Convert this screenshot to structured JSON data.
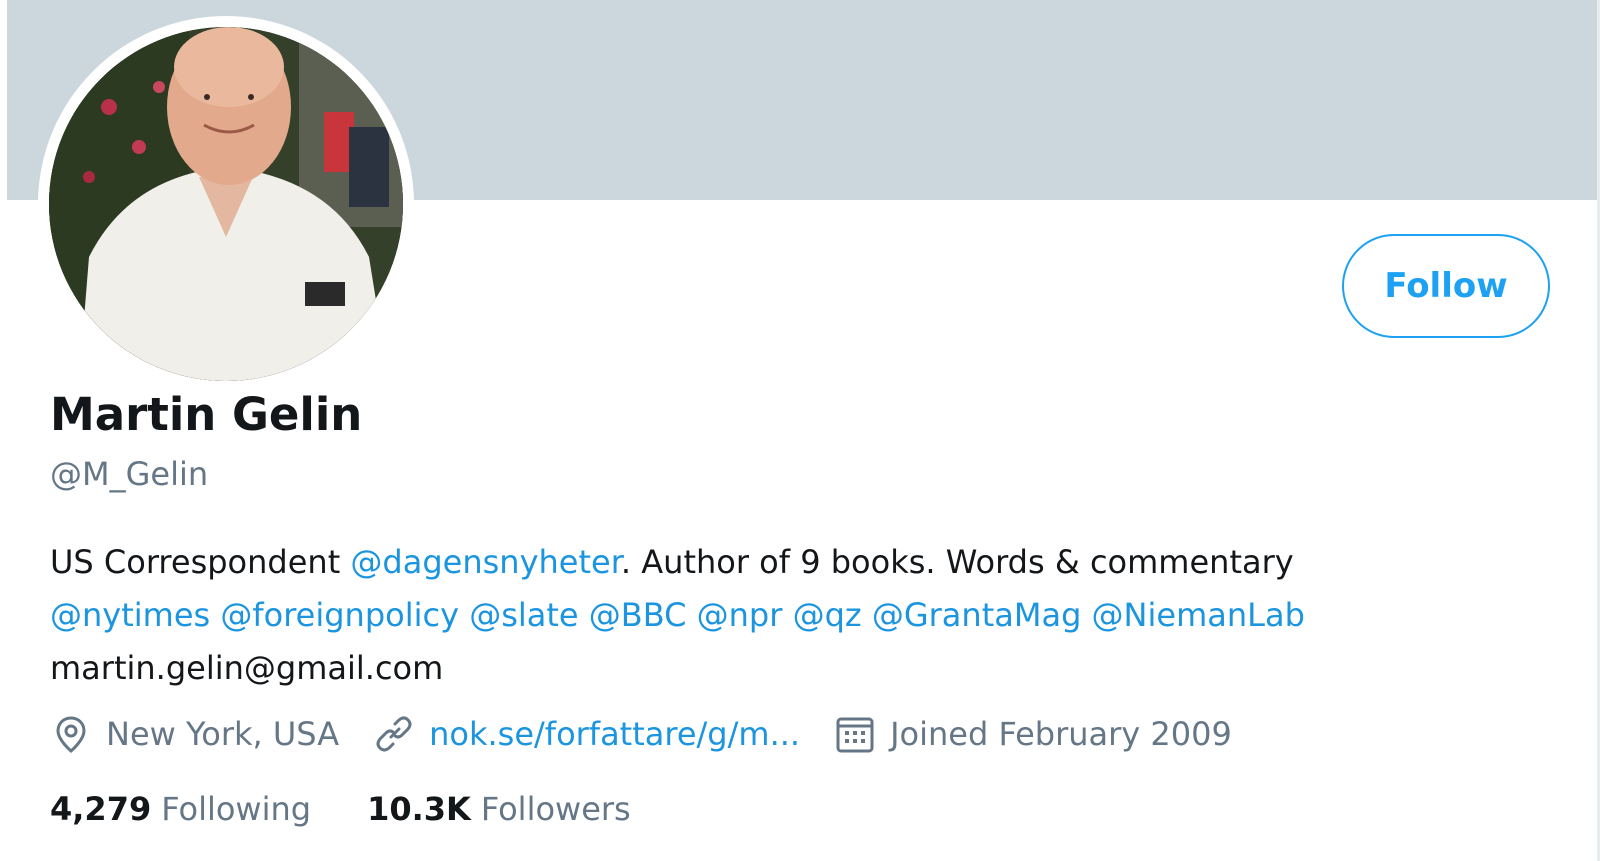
{
  "profile": {
    "name": "Martin Gelin",
    "handle": "@M_Gelin",
    "follow_label": "Follow",
    "bio": {
      "line1": {
        "text_a": "US Correspondent ",
        "mention": "@dagensnyheter",
        "text_b": ". Author of 9 books. Words & commentary"
      },
      "line2_mentions": [
        "@nytimes",
        "@foreignpolicy",
        "@slate",
        "@BBC",
        "@npr",
        "@qz",
        "@GrantaMag",
        "@NiemanLab"
      ],
      "line3": "martin.gelin@gmail.com"
    },
    "location": "New York, USA",
    "website": "nok.se/forfattare/g/m...",
    "joined": "Joined February 2009",
    "following_count": "4,279",
    "following_label": "Following",
    "followers_count": "10.3K",
    "followers_label": "Followers"
  },
  "icons": {
    "location": "location-pin-icon",
    "link": "link-icon",
    "calendar": "calendar-icon"
  },
  "colors": {
    "accent": "#1da1f2",
    "link": "#1b95e0",
    "banner": "#ccd6dd",
    "primary_text": "#14171a",
    "secondary_text": "#657786"
  }
}
